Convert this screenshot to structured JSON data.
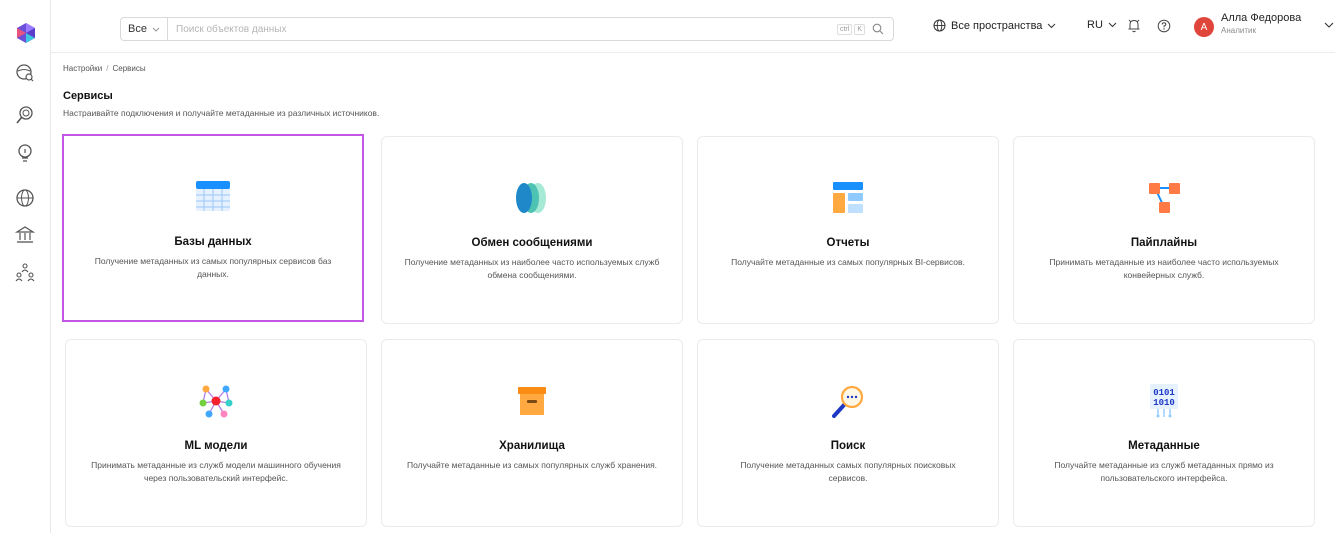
{
  "search": {
    "scope": "Все",
    "placeholder": "Поиск объектов данных",
    "shortcut_keys": [
      "ctrl",
      "K"
    ]
  },
  "header": {
    "spaces_label": "Все пространства",
    "language": "RU",
    "user": {
      "initial": "А",
      "name": "Алла Федорова",
      "role": "Аналитик"
    }
  },
  "breadcrumb": {
    "items": [
      "Настройки",
      "Сервисы"
    ],
    "separator": "/"
  },
  "page": {
    "title": "Сервисы",
    "subtitle": "Настраивайте подключения и получайте метаданные из различных источников."
  },
  "cards": [
    {
      "title": "Базы данных",
      "description": "Получение метаданных из самых популярных сервисов баз данных.",
      "icon": "database-icon",
      "selected": true
    },
    {
      "title": "Обмен сообщениями",
      "description": "Получение метаданных из наиболее часто используемых служб обмена сообщениями.",
      "icon": "messaging-icon",
      "selected": false
    },
    {
      "title": "Отчеты",
      "description": "Получайте метаданные из самых популярных BI-сервисов.",
      "icon": "dashboard-icon",
      "selected": false
    },
    {
      "title": "Пайплайны",
      "description": "Принимать метаданные из наиболее часто используемых конвейерных служб.",
      "icon": "pipeline-icon",
      "selected": false
    },
    {
      "title": "ML модели",
      "description": "Принимать метаданные из служб модели машинного обучения через пользовательский интерфейс.",
      "icon": "ml-model-icon",
      "selected": false
    },
    {
      "title": "Хранилища",
      "description": "Получайте метаданные из самых популярных служб хранения.",
      "icon": "storage-box-icon",
      "selected": false
    },
    {
      "title": "Поиск",
      "description": "Получение метаданных самых популярных поисковых сервисов.",
      "icon": "search-service-icon",
      "selected": false
    },
    {
      "title": "Метаданные",
      "description": "Получайте метаданные из служб метаданных прямо из пользовательского интерфейса.",
      "icon": "binary-metadata-icon",
      "selected": false
    }
  ],
  "colors": {
    "selected_border": "#c356e6",
    "avatar_bg": "#e0453b",
    "icon_blue": "#1890ff",
    "icon_orange": "#ff7a45"
  }
}
